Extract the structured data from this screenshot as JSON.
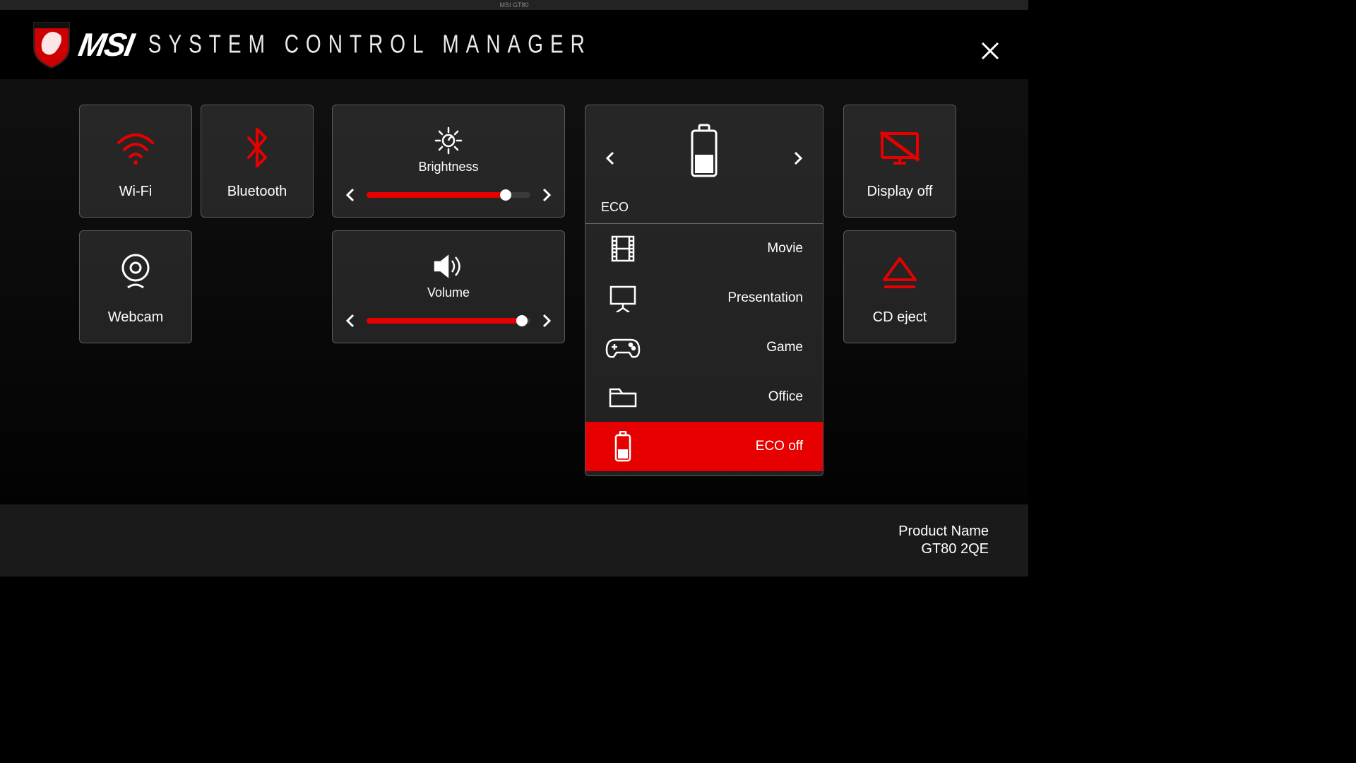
{
  "window": {
    "title": "MSI GT80"
  },
  "header": {
    "brand": "MSI",
    "app_title": "SYSTEM CONTROL MANAGER"
  },
  "tiles": {
    "wifi": {
      "label": "Wi-Fi",
      "active": true
    },
    "bluetooth": {
      "label": "Bluetooth",
      "active": true
    },
    "webcam": {
      "label": "Webcam",
      "active": false
    },
    "display_off": {
      "label": "Display off",
      "active": true
    },
    "cd_eject": {
      "label": "CD eject",
      "active": true
    }
  },
  "sliders": {
    "brightness": {
      "label": "Brightness",
      "value": 85,
      "max": 100
    },
    "volume": {
      "label": "Volume",
      "value": 95,
      "max": 100
    }
  },
  "eco": {
    "header_label": "ECO",
    "items": [
      {
        "label": "Movie",
        "icon": "film"
      },
      {
        "label": "Presentation",
        "icon": "presentation"
      },
      {
        "label": "Game",
        "icon": "gamepad"
      },
      {
        "label": "Office",
        "icon": "folder"
      },
      {
        "label": "ECO off",
        "icon": "battery",
        "selected": true
      }
    ]
  },
  "footer": {
    "product_label": "Product Name",
    "product_value": "GT80 2QE"
  },
  "colors": {
    "accent": "#e70000"
  }
}
